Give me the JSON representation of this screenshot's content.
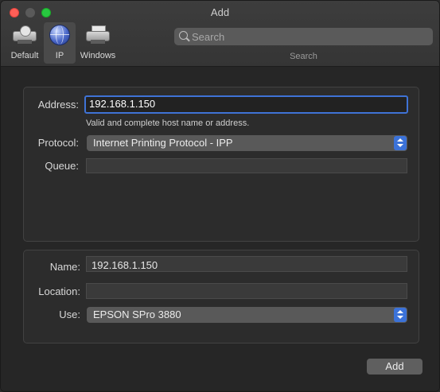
{
  "window": {
    "title": "Add"
  },
  "toolbar": {
    "tabs": [
      {
        "label": "Default",
        "icon": "default-printer-icon"
      },
      {
        "label": "IP",
        "icon": "globe-icon",
        "selected": true
      },
      {
        "label": "Windows",
        "icon": "windows-printer-icon"
      }
    ],
    "search": {
      "placeholder": "Search",
      "value": "",
      "caption": "Search"
    }
  },
  "form": {
    "address": {
      "label": "Address:",
      "value": "192.168.1.150",
      "hint": "Valid and complete host name or address."
    },
    "protocol": {
      "label": "Protocol:",
      "value": "Internet Printing Protocol - IPP"
    },
    "queue": {
      "label": "Queue:",
      "value": ""
    },
    "name": {
      "label": "Name:",
      "value": "192.168.1.150"
    },
    "location": {
      "label": "Location:",
      "value": ""
    },
    "use": {
      "label": "Use:",
      "value": "EPSON SPro 3880"
    }
  },
  "actions": {
    "add_label": "Add"
  },
  "colors": {
    "accent": "#3b72d9",
    "close": "#ff5f57",
    "zoom": "#28c840"
  }
}
